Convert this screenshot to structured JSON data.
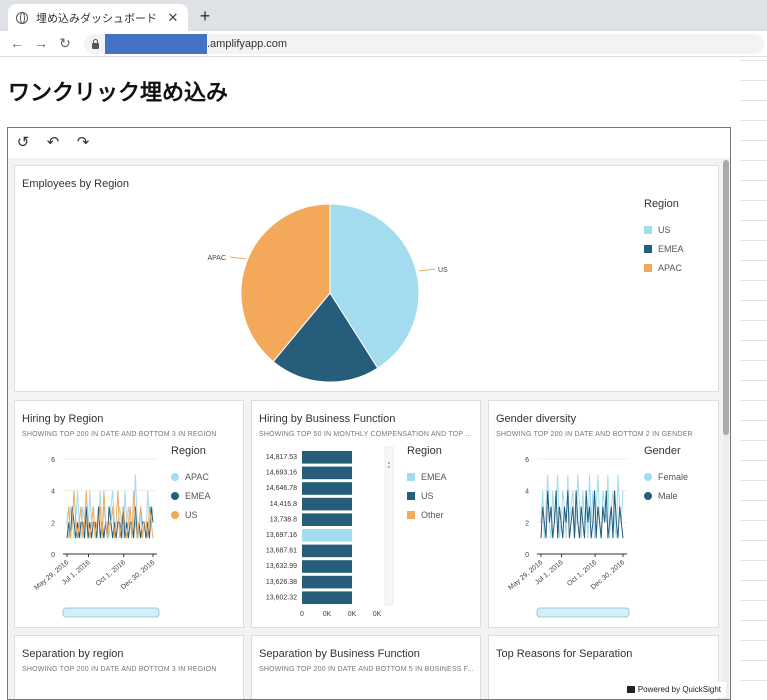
{
  "browser": {
    "tab_title": "埋め込みダッシュボード",
    "close": "✕",
    "new_tab": "+",
    "url_suffix": ".amplifyapp.com"
  },
  "page": {
    "title": "ワンクリック埋め込み"
  },
  "toolbar": {
    "reset": "↺",
    "undo": "↶",
    "redo": "↷"
  },
  "powered_by": "Powered by QuickSight",
  "colors": {
    "us": "#a2dcee",
    "emea": "#265d7b",
    "apac": "#f4a95a"
  },
  "cards": {
    "employees": {
      "title": "Employees by Region"
    },
    "hiring_region": {
      "title": "Hiring by Region",
      "subtitle": "SHOWING TOP 200 IN DATE AND BOTTOM 3 IN REGION"
    },
    "hiring_function": {
      "title": "Hiring by Business Function",
      "subtitle": "SHOWING TOP 50 IN MONTHLY COMPENSATION AND TOP ..."
    },
    "gender": {
      "title": "Gender diversity",
      "subtitle": "SHOWING TOP 200 IN DATE AND BOTTOM 2 IN GENDER"
    },
    "sep_region": {
      "title": "Separation by region",
      "subtitle": "SHOWING TOP 200 IN DATE AND BOTTOM 3 IN REGION"
    },
    "sep_function": {
      "title": "Separation by Business Function",
      "subtitle": "SHOWING TOP 200 IN DATE AND BOTTOM 5 IN BUSINESS F..."
    },
    "top_reasons": {
      "title": "Top Reasons for Separation"
    }
  },
  "chart_data": [
    {
      "type": "pie",
      "title": "Employees by Region",
      "categories": [
        "US",
        "EMEA",
        "APAC"
      ],
      "values": [
        41,
        20,
        39
      ],
      "slice_labels": [
        "US",
        "APAC"
      ],
      "legend": {
        "title": "Region",
        "position": "right",
        "entries": [
          "US",
          "EMEA",
          "APAC"
        ]
      }
    },
    {
      "type": "line",
      "title": "Hiring by Region",
      "ylim": [
        0,
        6
      ],
      "yticks": [
        "0",
        "2",
        "4",
        "6"
      ],
      "xticks": [
        "May 29, 2016",
        "Jul 1, 2016",
        "Oct 1, 2016",
        "Dec 30, 2016"
      ],
      "series": [
        {
          "name": "APAC",
          "values": [
            2,
            1,
            3,
            2,
            1,
            2,
            4,
            2,
            1,
            3,
            2,
            2,
            1,
            4,
            2,
            3,
            1,
            2,
            2,
            4,
            1,
            3,
            2,
            2,
            1,
            3,
            4,
            2,
            1,
            2,
            3,
            2,
            1,
            4,
            2,
            3,
            2,
            1,
            2,
            5,
            2,
            1,
            3,
            2,
            2,
            1,
            4,
            2,
            2,
            3
          ]
        },
        {
          "name": "EMEA",
          "values": [
            1,
            2,
            1,
            3,
            2,
            1,
            2,
            1,
            2,
            2,
            1,
            3,
            1,
            2,
            1,
            2,
            2,
            1,
            3,
            1,
            2,
            1,
            2,
            1,
            3,
            2,
            1,
            2,
            1,
            2,
            2,
            1,
            3,
            1,
            2,
            1,
            2,
            2,
            1,
            3,
            1,
            2,
            1,
            2,
            2,
            1,
            2,
            1,
            3,
            2
          ]
        },
        {
          "name": "US",
          "values": [
            2,
            3,
            1,
            2,
            4,
            2,
            1,
            2,
            3,
            1,
            2,
            4,
            2,
            1,
            2,
            3,
            1,
            2,
            2,
            3,
            1,
            4,
            2,
            1,
            2,
            2,
            3,
            1,
            2,
            4,
            1,
            2,
            3,
            2,
            1,
            2,
            3,
            1,
            4,
            2,
            1,
            2,
            3,
            1,
            2,
            2,
            1,
            3,
            2,
            1
          ]
        }
      ],
      "legend": {
        "title": "Region",
        "position": "right",
        "entries": [
          "APAC",
          "EMEA",
          "US"
        ]
      }
    },
    {
      "type": "bar",
      "title": "Hiring by Business Function",
      "categories": [
        "14,817.53",
        "14,693.16",
        "14,646.78",
        "14,416.8",
        "13,738.8",
        "13,697.16",
        "13,687.61",
        "13,632.99",
        "13,626.38",
        "13,602.32"
      ],
      "highlight_index": 5,
      "xticks": [
        "0",
        "0K",
        "0K",
        "0K"
      ],
      "legend": {
        "title": "Region",
        "position": "right",
        "entries": [
          "EMEA",
          "US",
          "Other"
        ]
      }
    },
    {
      "type": "line",
      "title": "Gender diversity",
      "ylim": [
        0,
        6
      ],
      "yticks": [
        "0",
        "2",
        "4",
        "6"
      ],
      "xticks": [
        "May 29, 2016",
        "Jul 1, 2016",
        "Oct 1, 2016",
        "Dec 30, 2016"
      ],
      "series": [
        {
          "name": "Female",
          "values": [
            2,
            4,
            1,
            3,
            5,
            2,
            1,
            4,
            2,
            3,
            5,
            1,
            2,
            4,
            3,
            1,
            5,
            2,
            3,
            4,
            1,
            2,
            5,
            3,
            1,
            4,
            2,
            3,
            1,
            5,
            2,
            4,
            1,
            3,
            5,
            2,
            1,
            4,
            3,
            2,
            5,
            1,
            3,
            4,
            2,
            1,
            5,
            3,
            2,
            4
          ]
        },
        {
          "name": "Male",
          "values": [
            1,
            3,
            2,
            1,
            4,
            2,
            3,
            1,
            2,
            4,
            1,
            3,
            2,
            1,
            3,
            2,
            4,
            1,
            2,
            3,
            1,
            4,
            2,
            1,
            3,
            2,
            1,
            4,
            2,
            3,
            1,
            2,
            4,
            1,
            3,
            2,
            1,
            3,
            2,
            4,
            1,
            2,
            3,
            1,
            4,
            2,
            1,
            3,
            2,
            1
          ]
        }
      ],
      "legend": {
        "title": "Gender",
        "position": "right",
        "entries": [
          "Female",
          "Male"
        ]
      }
    }
  ]
}
